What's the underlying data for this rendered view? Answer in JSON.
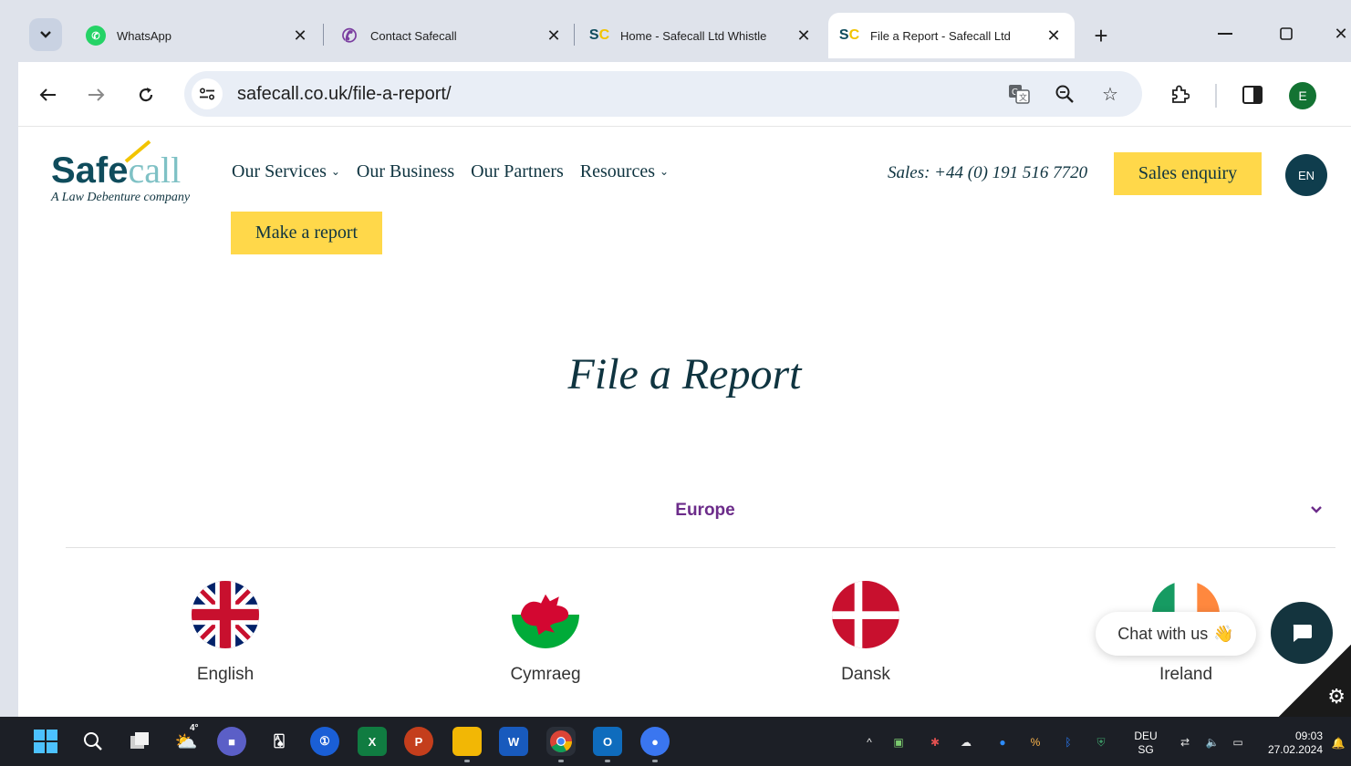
{
  "browser": {
    "tabs": [
      {
        "title": "WhatsApp",
        "favicon": "whatsapp-icon",
        "active": false
      },
      {
        "title": "Contact Safecall",
        "favicon": "phone-icon",
        "active": false
      },
      {
        "title": "Home - Safecall Ltd Whistle",
        "favicon": "safecall-icon",
        "active": false
      },
      {
        "title": "File a Report - Safecall Ltd",
        "favicon": "safecall-icon",
        "active": true
      }
    ],
    "new_tab_label": "+",
    "url": "safecall.co.uk/file-a-report/",
    "profile_initial": "E"
  },
  "site": {
    "logo": {
      "word_dark": "Safe",
      "word_light": "call",
      "tagline": "A Law Debenture company"
    },
    "nav": [
      {
        "label": "Our Services",
        "has_dropdown": true
      },
      {
        "label": "Our Business",
        "has_dropdown": false
      },
      {
        "label": "Our Partners",
        "has_dropdown": false
      },
      {
        "label": "Resources",
        "has_dropdown": true
      }
    ],
    "sales_phone": "Sales: +44 (0) 191 516 7720",
    "sales_enquiry_label": "Sales enquiry",
    "language_code": "EN",
    "make_report_label": "Make a report",
    "page_title": "File a Report",
    "region": "Europe",
    "languages": [
      {
        "name": "English",
        "flag": "uk-flag-icon"
      },
      {
        "name": "Cymraeg",
        "flag": "wales-flag-icon"
      },
      {
        "name": "Dansk",
        "flag": "denmark-flag-icon"
      },
      {
        "name": "Ireland",
        "flag": "ireland-flag-icon"
      }
    ],
    "chat_label": "Chat with us",
    "colors": {
      "yellow": "#ffd84a",
      "navy": "#0f3440",
      "purple": "#6c2c8a",
      "teal": "#7fc1c5"
    }
  },
  "taskbar": {
    "weather_temp": "4°",
    "language": "DEU",
    "layout": "SG",
    "time": "09:03",
    "date": "27.02.2024"
  }
}
